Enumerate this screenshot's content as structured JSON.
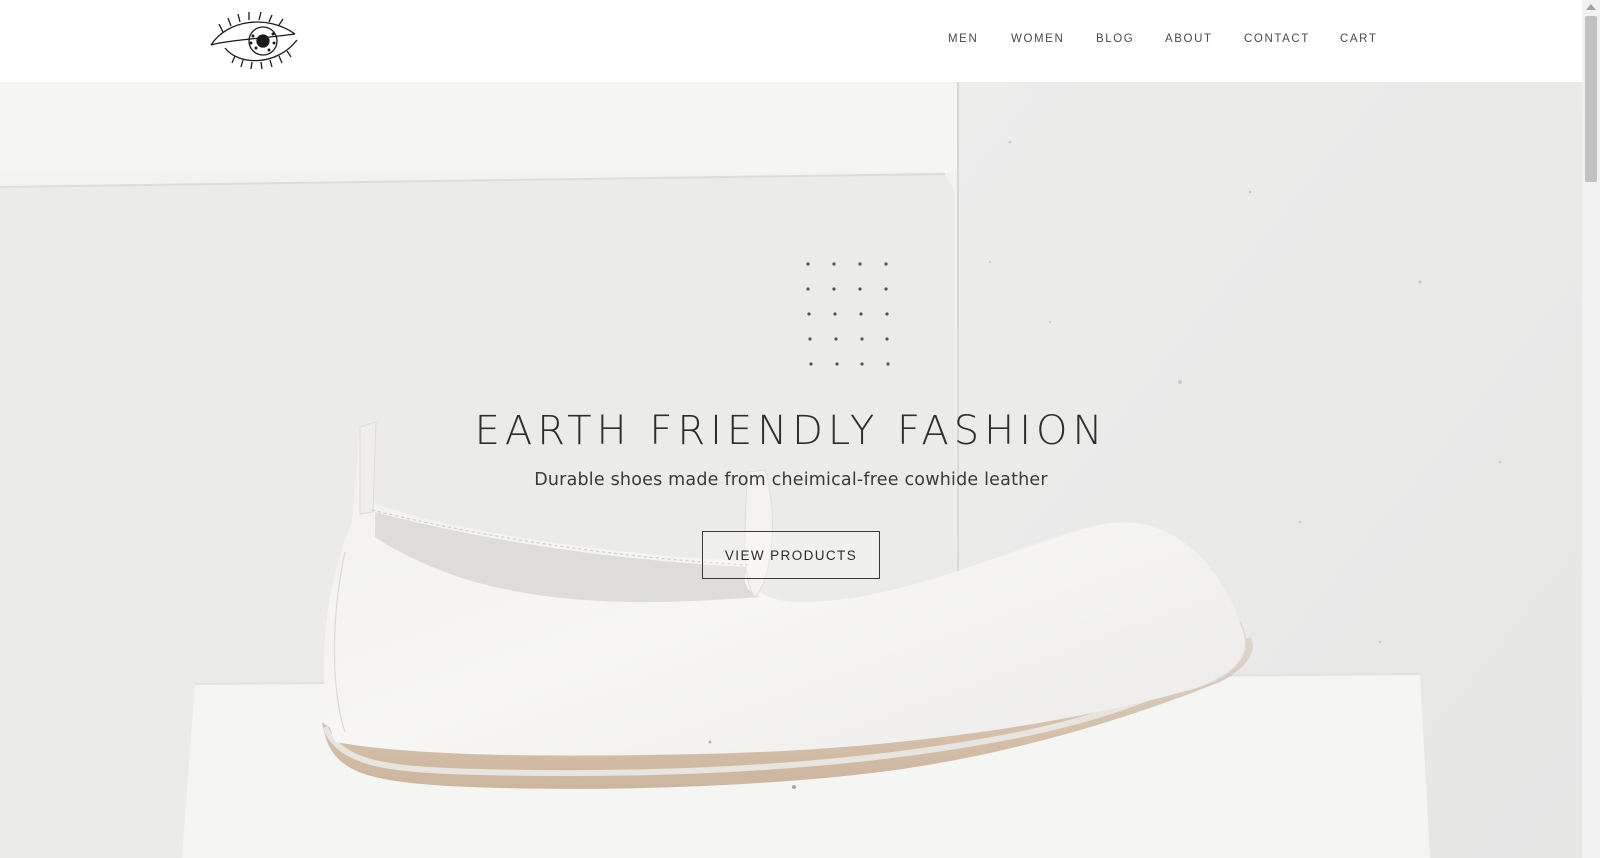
{
  "brand": {
    "logo_icon": "eye-logo-icon"
  },
  "nav": {
    "items": [
      {
        "label": "MEN"
      },
      {
        "label": "WOMEN"
      },
      {
        "label": "BLOG"
      },
      {
        "label": "ABOUT"
      },
      {
        "label": "CONTACT"
      },
      {
        "label": "CART"
      }
    ]
  },
  "hero": {
    "title": "EARTH FRIENDLY FASHION",
    "subtitle": "Durable shoes made from cheimical-free cowhide leather",
    "button_label": "VIEW PRODUCTS",
    "decoration_icon": "dot-grid-icon",
    "image": "white-leather-slipper-shoe"
  },
  "colors": {
    "header_bg": "#ffffff",
    "hero_bg": "#ececeb",
    "text": "#2e2e2e",
    "nav_text": "#4a4a4a"
  }
}
